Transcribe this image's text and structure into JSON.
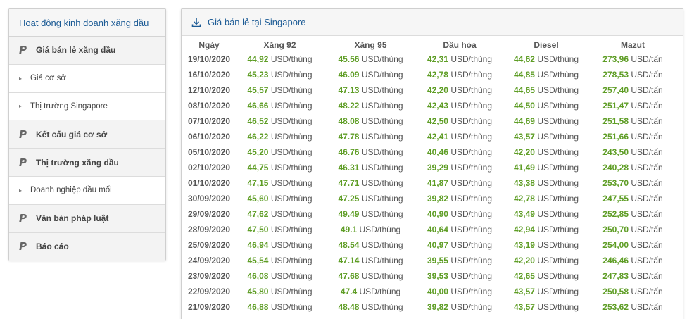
{
  "sidebar": {
    "title": "Hoạt động kinh doanh xăng dầu",
    "items": [
      {
        "type": "main",
        "icon": "p-icon",
        "label": "Giá bán lẻ xăng dầu"
      },
      {
        "type": "sub",
        "icon": "caret-right-icon",
        "label": "Giá cơ sở"
      },
      {
        "type": "sub",
        "icon": "caret-right-icon",
        "label": "Thị trường Singapore"
      },
      {
        "type": "main",
        "icon": "p-icon",
        "label": "Kết cấu giá cơ sở"
      },
      {
        "type": "main",
        "icon": "p-icon",
        "label": "Thị trường xăng dầu"
      },
      {
        "type": "sub",
        "icon": "caret-right-icon",
        "label": "Doanh nghiệp đầu mối"
      },
      {
        "type": "main",
        "icon": "p-icon",
        "label": "Văn bản pháp luật"
      },
      {
        "type": "main",
        "icon": "p-icon",
        "label": "Báo cáo"
      }
    ],
    "p_glyph": "P",
    "caret_glyph": "▸"
  },
  "panel": {
    "title": "Giá bán lẻ tại Singapore",
    "icon": "download-icon",
    "columns": [
      "Ngày",
      "Xăng 92",
      "Xăng 95",
      "Dầu hỏa",
      "Diesel",
      "Mazut"
    ],
    "rows": [
      {
        "date": "19/10/2020",
        "x92": "44,92",
        "x95": "45.56",
        "dh": "42,31",
        "ds": "44,62",
        "mz": "273,96"
      },
      {
        "date": "16/10/2020",
        "x92": "45,23",
        "x95": "46.09",
        "dh": "42,78",
        "ds": "44,85",
        "mz": "278,53"
      },
      {
        "date": "12/10/2020",
        "x92": "45,57",
        "x95": "47.13",
        "dh": "42,20",
        "ds": "44,65",
        "mz": "257,40"
      },
      {
        "date": "08/10/2020",
        "x92": "46,66",
        "x95": "48.22",
        "dh": "42,43",
        "ds": "44,50",
        "mz": "251,47"
      },
      {
        "date": "07/10/2020",
        "x92": "46,52",
        "x95": "48.08",
        "dh": "42,50",
        "ds": "44,69",
        "mz": "251,58"
      },
      {
        "date": "06/10/2020",
        "x92": "46,22",
        "x95": "47.78",
        "dh": "42,41",
        "ds": "43,57",
        "mz": "251,66"
      },
      {
        "date": "05/10/2020",
        "x92": "45,20",
        "x95": "46.76",
        "dh": "40,46",
        "ds": "42,20",
        "mz": "243,50"
      },
      {
        "date": "02/10/2020",
        "x92": "44,75",
        "x95": "46.31",
        "dh": "39,29",
        "ds": "41,49",
        "mz": "240,28"
      },
      {
        "date": "01/10/2020",
        "x92": "47,15",
        "x95": "47.71",
        "dh": "41,87",
        "ds": "43,38",
        "mz": "253,70"
      },
      {
        "date": "30/09/2020",
        "x92": "45,60",
        "x95": "47.25",
        "dh": "39,82",
        "ds": "42,78",
        "mz": "247,55"
      },
      {
        "date": "29/09/2020",
        "x92": "47,62",
        "x95": "49.49",
        "dh": "40,90",
        "ds": "43,49",
        "mz": "252,85"
      },
      {
        "date": "28/09/2020",
        "x92": "47,50",
        "x95": "49.1",
        "dh": "40,64",
        "ds": "42,94",
        "mz": "250,70"
      },
      {
        "date": "25/09/2020",
        "x92": "46,94",
        "x95": "48.54",
        "dh": "40,97",
        "ds": "43,19",
        "mz": "254,00"
      },
      {
        "date": "24/09/2020",
        "x92": "45,54",
        "x95": "47.14",
        "dh": "39,55",
        "ds": "42,20",
        "mz": "246,46"
      },
      {
        "date": "23/09/2020",
        "x92": "46,08",
        "x95": "47.68",
        "dh": "39,53",
        "ds": "42,65",
        "mz": "247,83"
      },
      {
        "date": "22/09/2020",
        "x92": "45,80",
        "x95": "47.4",
        "dh": "40,00",
        "ds": "43,57",
        "mz": "250,58"
      },
      {
        "date": "21/09/2020",
        "x92": "46,88",
        "x95": "48.48",
        "dh": "39,82",
        "ds": "43,57",
        "mz": "253,62"
      }
    ],
    "unit_barrel": "USD/thùng",
    "unit_ton": "USD/tấn"
  },
  "colors": {
    "accent": "#1c5b95",
    "value_green": "#5e9d25"
  }
}
